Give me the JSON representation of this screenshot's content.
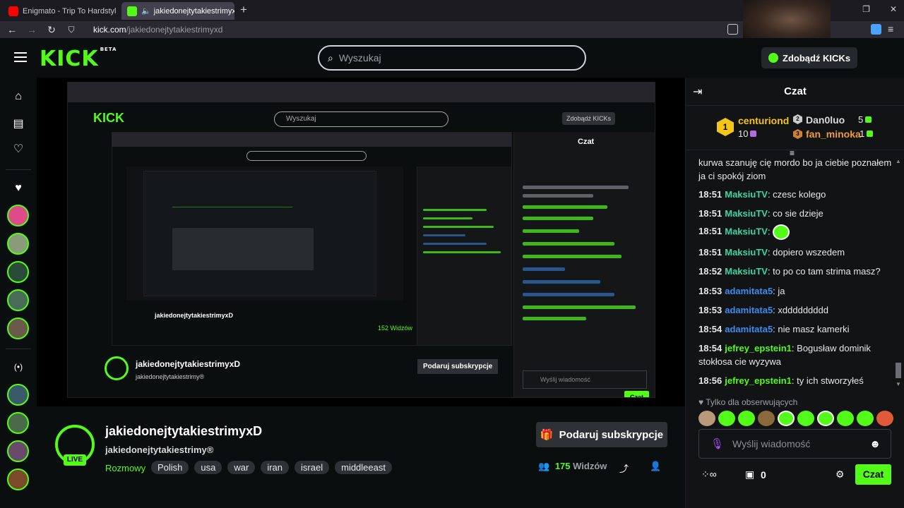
{
  "browser": {
    "tabs": [
      {
        "title": "Enigmato - Trip To Hardstyl",
        "favicon": "youtube-icon"
      },
      {
        "title": "jakiedonejtytakiestrimyxD S",
        "favicon": "kick-icon"
      }
    ],
    "url_host": "kick.com",
    "url_path": "/jakiedonejtytakiestrimyxd"
  },
  "header": {
    "logo": "KICK",
    "logo_badge": "BETA",
    "search_placeholder": "Wyszukaj",
    "kicks_button": "Zdobądź KICKs"
  },
  "stream": {
    "channel_name": "jakiedonejtytakiestrimyxD",
    "title": "jakiedonejtytakiestrimy®",
    "live_label": "LIVE",
    "category": "Rozmowy",
    "tags": [
      "Polish",
      "usa",
      "war",
      "iran",
      "israel",
      "middleeast"
    ],
    "sub_button": "Podaruj subskrypcje",
    "viewers": "175",
    "viewers_label": "Widzów"
  },
  "chat": {
    "title": "Czat",
    "leaderboard": {
      "first": {
        "name": "centuriond",
        "count": "10",
        "rank": "1"
      },
      "second": {
        "name": "Dan0luo",
        "count": "5"
      },
      "third": {
        "name": "fan_minoka",
        "count": "1"
      }
    },
    "messages": [
      {
        "time": "",
        "user": "",
        "text": "kurwa szanuję cię mordo bo ja ciebie poznałem ja ci spokój ziom",
        "color": "#e6e8ea"
      },
      {
        "time": "18:51",
        "user": "MaksiuTV",
        "text": "czesc kolego",
        "color": "#3cd6a0"
      },
      {
        "time": "18:51",
        "user": "MaksiuTV",
        "text": "co sie dzieje",
        "color": "#3cd6a0"
      },
      {
        "time": "18:51",
        "user": "MaksiuTV",
        "text": "",
        "color": "#3cd6a0",
        "emote": true
      },
      {
        "time": "18:51",
        "user": "MaksiuTV",
        "text": "dopiero wszedem",
        "color": "#3cd6a0"
      },
      {
        "time": "18:52",
        "user": "MaksiuTV",
        "text": "to po co tam strima masz?",
        "color": "#3cd6a0"
      },
      {
        "time": "18:53",
        "user": "adamitata5",
        "text": "ja",
        "color": "#3c8cf0"
      },
      {
        "time": "18:53",
        "user": "adamitata5",
        "text": "xddddddddd",
        "color": "#3c8cf0"
      },
      {
        "time": "18:54",
        "user": "adamitata5",
        "text": "nie masz kamerki",
        "color": "#3c8cf0"
      },
      {
        "time": "18:54",
        "user": "jefrey_epstein1",
        "text": "Bogusław dominik stokłosa cie wyzywa",
        "color": "#53fc18"
      },
      {
        "time": "18:56",
        "user": "jefrey_epstein1",
        "text": "ty ich stworzyłeś",
        "color": "#53fc18"
      }
    ],
    "followers_only": "Tylko dla obserwujących",
    "input_placeholder": "Wyślij wiadomość",
    "kicks_count": "0",
    "send_button": "Czat"
  },
  "nested": {
    "chat_title": "Czat",
    "search": "Wyszukaj",
    "kicks_button": "Zdobądź KICKs",
    "viewers_small": "152 Widzów",
    "input_placeholder": "Wyślij wiadomość",
    "send": "Czat"
  },
  "colors": {
    "accent": "#53fc18",
    "background": "#0b0e0f",
    "chat_bg": "#111315"
  }
}
